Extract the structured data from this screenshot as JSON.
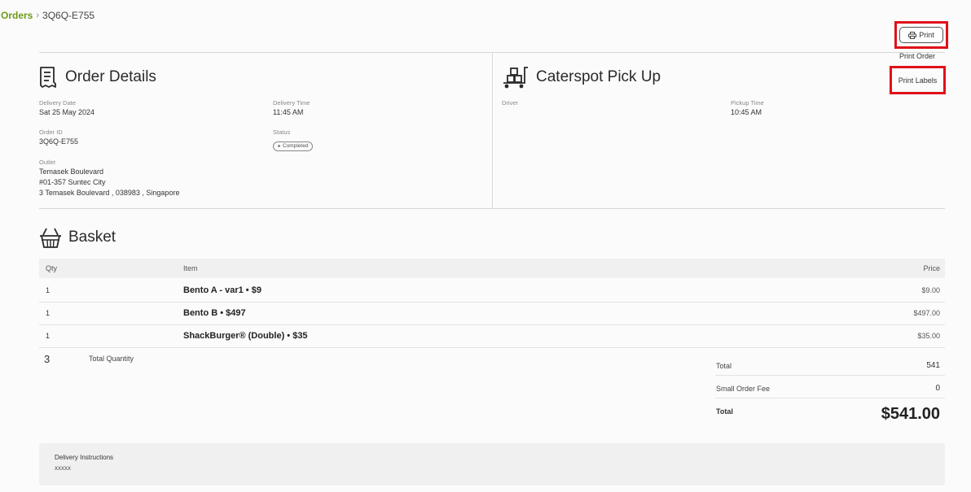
{
  "breadcrumb": {
    "root": "Orders",
    "separator": "›",
    "current": "3Q6Q-E755"
  },
  "actions": {
    "print_label": "Print",
    "print_order_label": "Print Order",
    "print_labels_label": "Print Labels",
    "highlight_color": "#e0101a"
  },
  "order_details": {
    "title": "Order Details",
    "delivery_date_label": "Delivery Date",
    "delivery_date": "Sat 25 May 2024",
    "delivery_time_label": "Delivery Time",
    "delivery_time": "11:45 AM",
    "order_id_label": "Order ID",
    "order_id": "3Q6Q-E755",
    "status_label": "Status",
    "status": "Completed",
    "outlet_label": "Outlet",
    "outlet_name": "Temasek Boulevard",
    "outlet_unit": "#01-357 Suntec City",
    "outlet_address": "3 Temasek Boulevard , 038983 , Singapore"
  },
  "pickup": {
    "title": "Caterspot Pick Up",
    "driver_label": "Driver",
    "pickup_time_label": "Pickup Time",
    "pickup_time": "10:45 AM"
  },
  "basket": {
    "title": "Basket",
    "columns": {
      "qty": "Qty",
      "item": "Item",
      "price": "Price"
    },
    "rows": [
      {
        "qty": "1",
        "item": "Bento A - var1 • $9",
        "price": "$9.00"
      },
      {
        "qty": "1",
        "item": "Bento B • $497",
        "price": "$497.00"
      },
      {
        "qty": "1",
        "item": "ShackBurger® (Double) • $35",
        "price": "$35.00"
      }
    ],
    "total_quantity_value": "3",
    "total_quantity_label": "Total Quantity"
  },
  "totals": {
    "total_label": "Total",
    "total_value": "541",
    "small_fee_label": "Small Order Fee",
    "small_fee_value": "0",
    "grand_label": "Total",
    "grand_value": "$541.00"
  },
  "instructions": {
    "label": "Delivery Instructions",
    "value": "xxxxx"
  },
  "colors": {
    "accent_green": "#6e9a1a"
  }
}
